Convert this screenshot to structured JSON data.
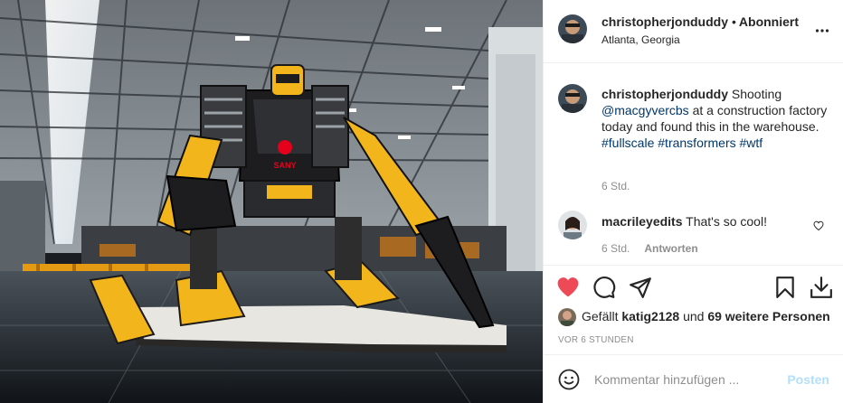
{
  "header": {
    "username": "christopherjonduddy",
    "separator": "•",
    "follow_status": "Abonniert",
    "location": "Atlanta, Georgia"
  },
  "caption": {
    "username": "christopherjonduddy",
    "text_1": "Shooting",
    "mention": "@macgyvercbs",
    "text_2": "at a construction factory today and found this in the warehouse.",
    "hashtag_1": "#fullscale",
    "hashtag_2": "#transformers",
    "hashtag_3": "#wtf",
    "time": "6 Std."
  },
  "comment": {
    "username": "macrileyedits",
    "text": "That's so cool!",
    "time": "6 Std.",
    "reply_label": "Antworten"
  },
  "likes": {
    "prefix": "Gefällt",
    "user": "katig2128",
    "middle": "und",
    "others": "69 weitere Personen"
  },
  "posted_ago": "VOR 6 STUNDEN",
  "comment_input": {
    "placeholder": "Kommentar hinzufügen ...",
    "post_label": "Posten"
  },
  "photo": {
    "robot_logo_text": "SANY"
  },
  "colors": {
    "like_red": "#ed4956",
    "link_blue": "#00376b",
    "post_disabled": "#b2dffc",
    "robot_yellow": "#f3b51c"
  }
}
